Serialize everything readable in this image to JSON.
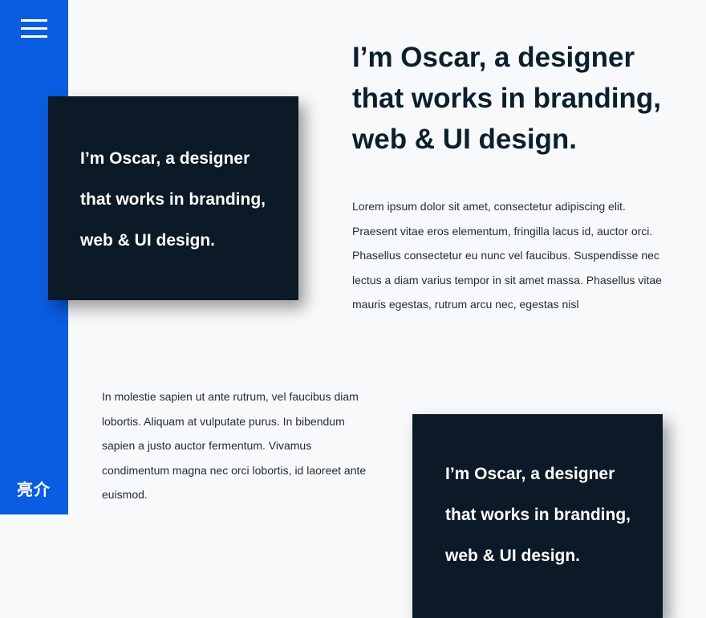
{
  "sidebar": {
    "menu_icon": "hamburger-menu-icon",
    "label": "亮介",
    "color": "#0a5ce0"
  },
  "headline": "I’m Oscar, a designer that works in branding, web & UI design.",
  "cards": [
    {
      "text": "I’m Oscar, a designer that works in branding, web & UI design."
    },
    {
      "text": "I’m Oscar, a designer that works in branding, web & UI design."
    }
  ],
  "paragraphs": [
    "Lorem ipsum dolor sit amet, consectetur adipiscing elit. Praesent vitae eros elementum, fringilla lacus id, auctor orci. Phasellus consectetur eu nunc vel faucibus. Suspendisse nec lectus a diam varius tempor in sit amet massa. Phasellus vitae mauris egestas, rutrum arcu nec, egestas nisl",
    "In molestie sapien ut ante rutrum, vel faucibus diam lobortis. Aliquam at vulputate purus. In bibendum sapien a justo auctor fermentum. Vivamus condimentum magna nec orci lobortis, id laoreet ante euismod."
  ]
}
